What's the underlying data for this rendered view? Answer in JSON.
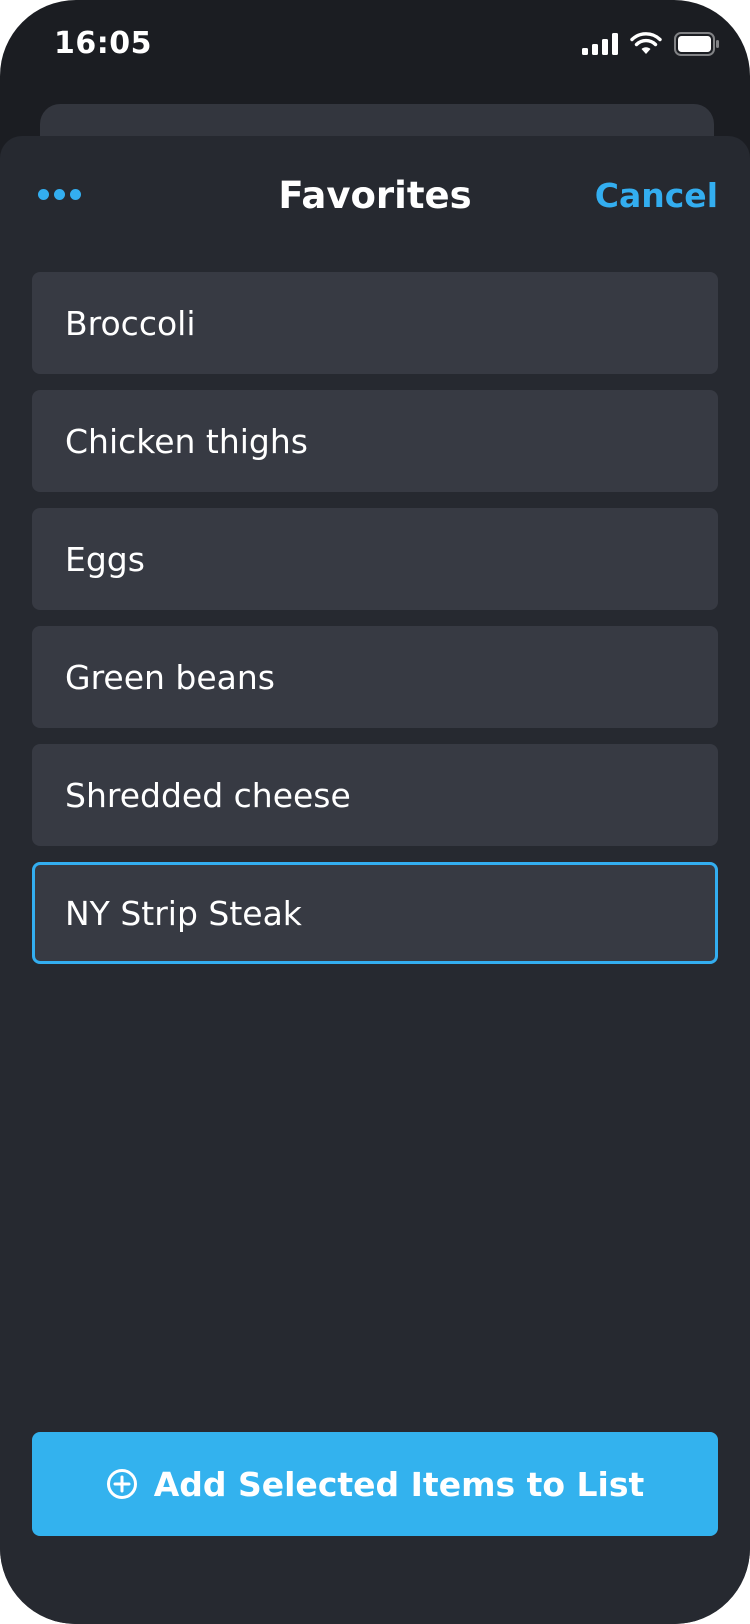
{
  "status_bar": {
    "time": "16:05",
    "icons": [
      "signal-icon",
      "wifi-icon",
      "battery-icon"
    ]
  },
  "header": {
    "more_icon": "ellipsis-icon",
    "title": "Favorites",
    "cancel_label": "Cancel"
  },
  "favorites": {
    "items": [
      {
        "label": "Broccoli",
        "selected": false
      },
      {
        "label": "Chicken thighs",
        "selected": false
      },
      {
        "label": "Eggs",
        "selected": false
      },
      {
        "label": "Green beans",
        "selected": false
      },
      {
        "label": "Shredded cheese",
        "selected": false
      },
      {
        "label": "NY Strip Steak",
        "selected": true
      }
    ]
  },
  "footer": {
    "add_icon": "add-circle-icon",
    "add_label": "Add Selected Items to List"
  },
  "colors": {
    "accent": "#33aef0",
    "background": "#1b1d22",
    "sheet": "#262930",
    "item": "#373a43",
    "button": "#33b2ee"
  }
}
